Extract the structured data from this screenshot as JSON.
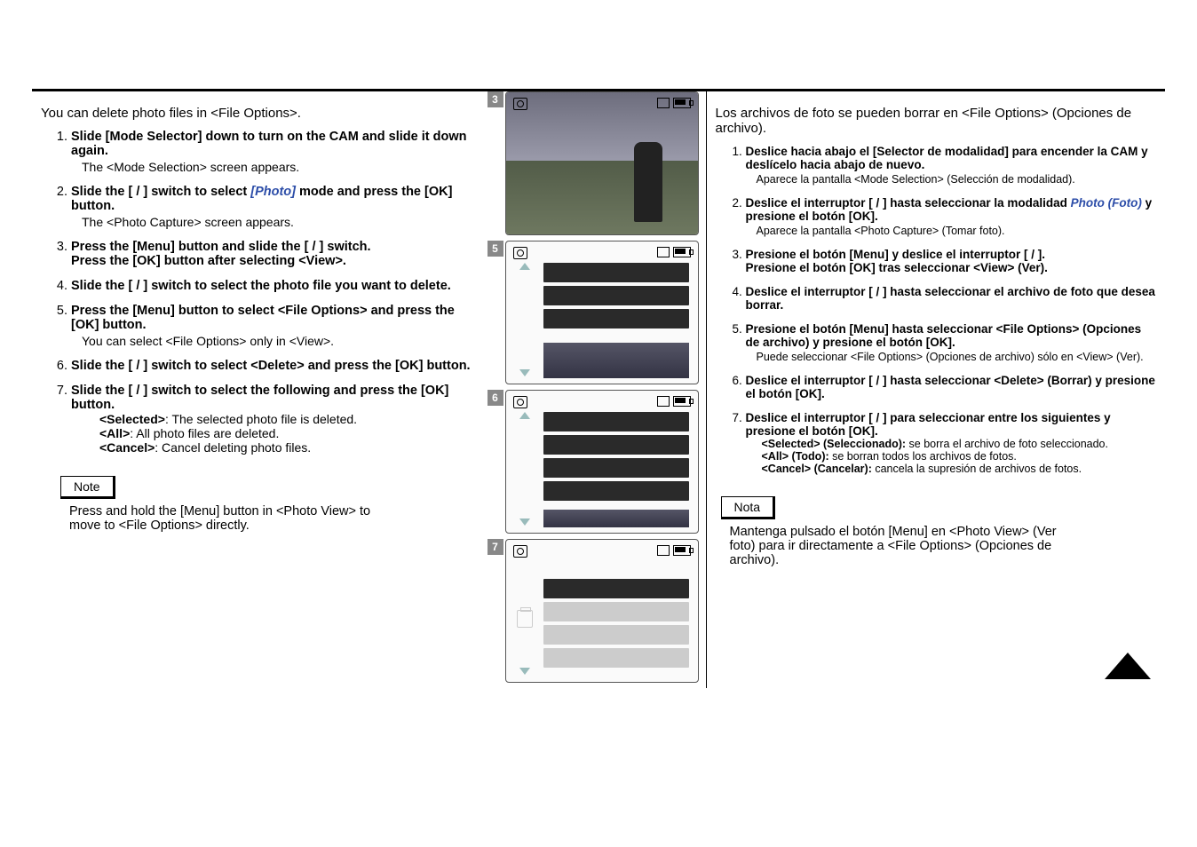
{
  "en": {
    "intro": "You can delete photo files in <File Options>.",
    "steps": [
      {
        "head": "Slide [Mode Selector] down to turn on the CAM and slide it down again.",
        "sub": "The <Mode Selection> screen appears."
      },
      {
        "head_pre": "Slide the [   /   ] switch to select ",
        "head_mode": "[Photo]",
        "head_post": " mode and press the [OK] button.",
        "sub": "The <Photo Capture> screen appears."
      },
      {
        "head": "Press the [Menu] button and slide the [   /   ] switch.\nPress the [OK] button after selecting <View>.",
        "sub": ""
      },
      {
        "head": "Slide the [   /   ] switch to select the photo file you want to delete.",
        "sub": ""
      },
      {
        "head": "Press the [Menu] button to select <File Options> and press the [OK] button.",
        "sub": "You can select <File Options> only in <View>."
      },
      {
        "head": "Slide the [   /   ] switch to select <Delete> and press the [OK] button.",
        "sub": ""
      },
      {
        "head": "Slide the [   /   ] switch to select the following and press the [OK] button.",
        "defs": [
          {
            "k": "<Selected>",
            "v": ": The selected photo file is deleted."
          },
          {
            "k": "<All>",
            "v": ": All photo files are deleted."
          },
          {
            "k": "<Cancel>",
            "v": ": Cancel deleting photo files."
          }
        ]
      }
    ],
    "note_label": "Note",
    "note_text": "Press and hold the [Menu] button in <Photo View> to move to <File Options> directly."
  },
  "es": {
    "intro": "Los archivos de foto se pueden borrar en <File Options> (Opciones de archivo).",
    "steps": [
      {
        "head": "Deslice hacia abajo el [Selector de modalidad] para encender la CAM y deslícelo hacia abajo de nuevo.",
        "sub": "Aparece la pantalla <Mode Selection> (Selección de modalidad)."
      },
      {
        "head_pre": "Deslice el interruptor [   /   ] hasta seleccionar la modalidad ",
        "head_mode": "Photo (Foto)",
        "head_post": " y presione el botón [OK].",
        "sub": "Aparece la pantalla <Photo Capture> (Tomar foto)."
      },
      {
        "head": "Presione el botón [Menu] y deslice el interruptor [   /   ].\nPresione el botón [OK] tras seleccionar <View> (Ver).",
        "sub": ""
      },
      {
        "head": "Deslice el interruptor [   /   ] hasta seleccionar el archivo de foto que desea borrar.",
        "sub": ""
      },
      {
        "head": "Presione el botón [Menu] hasta seleccionar <File Options> (Opciones de archivo) y presione el botón [OK].",
        "sub": "Puede seleccionar <File Options> (Opciones de archivo) sólo en <View> (Ver)."
      },
      {
        "head": "Deslice el interruptor [   /   ] hasta seleccionar <Delete> (Borrar) y presione el botón [OK].",
        "sub": ""
      },
      {
        "head": "Deslice el interruptor [   /   ] para seleccionar entre los siguientes y presione el botón [OK].",
        "defs": [
          {
            "k": "<Selected> (Seleccionado):",
            "v": " se borra el archivo de foto seleccionado."
          },
          {
            "k": "<All> (Todo):",
            "v": " se borran todos los archivos de fotos."
          },
          {
            "k": "<Cancel> (Cancelar):",
            "v": " cancela la supresión de archivos de fotos."
          }
        ]
      }
    ],
    "note_label": "Nota",
    "note_text": "Mantenga pulsado el botón [Menu] en <Photo View> (Ver foto) para ir directamente a <File Options> (Opciones de archivo)."
  },
  "thumbs": {
    "ids": [
      "3",
      "5",
      "6",
      "7"
    ]
  }
}
